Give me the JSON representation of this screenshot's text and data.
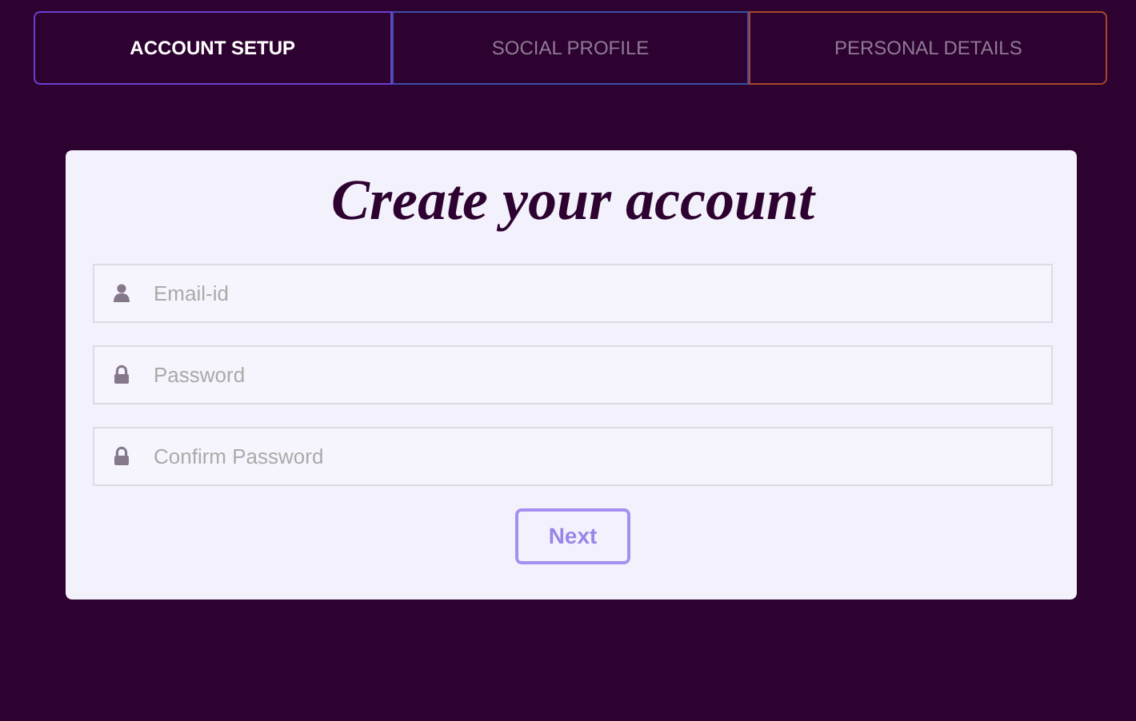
{
  "tabs": [
    {
      "label": "ACCOUNT SETUP",
      "selected": true,
      "color": "#6a3fd0"
    },
    {
      "label": "SOCIAL PROFILE",
      "selected": false,
      "color": "#3a4fa8"
    },
    {
      "label": "PERSONAL DETAILS",
      "selected": false,
      "color": "#a8452a"
    }
  ],
  "form": {
    "title": "Create your account",
    "fields": [
      {
        "kind": "user",
        "placeholder": "Email-id"
      },
      {
        "kind": "lock",
        "placeholder": "Password"
      },
      {
        "kind": "lock",
        "placeholder": "Confirm Password"
      }
    ],
    "button": "Next"
  }
}
